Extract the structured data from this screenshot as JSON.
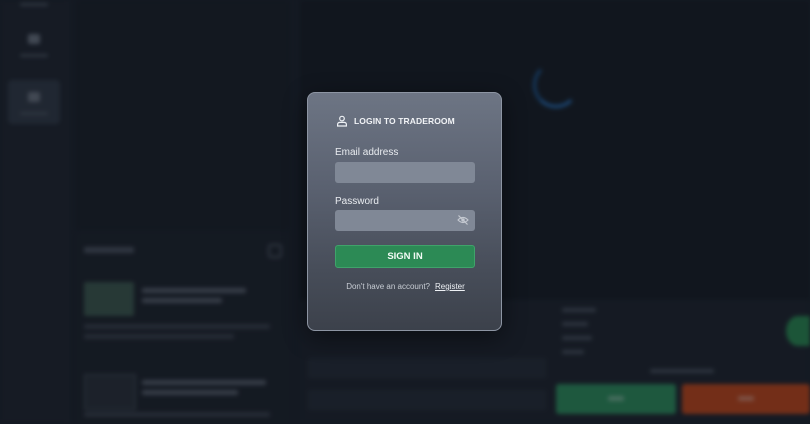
{
  "login": {
    "title": "LOGIN TO TRADEROOM",
    "email_label": "Email address",
    "email_value": "",
    "password_label": "Password",
    "password_value": "",
    "password_toggle_icon": "eye-off-icon",
    "signin_label": "SIGN IN",
    "no_account_text": "Don't have an account?",
    "register_label": "Register"
  },
  "colors": {
    "signin_green": "#2c8a55",
    "buy_green": "#2e9460",
    "sell_orange": "#c8481b",
    "spinner_blue": "#2b78c7",
    "background": "#1c222d"
  },
  "icons": {
    "title_icon": "user-icon",
    "loading": "spinner-icon"
  }
}
